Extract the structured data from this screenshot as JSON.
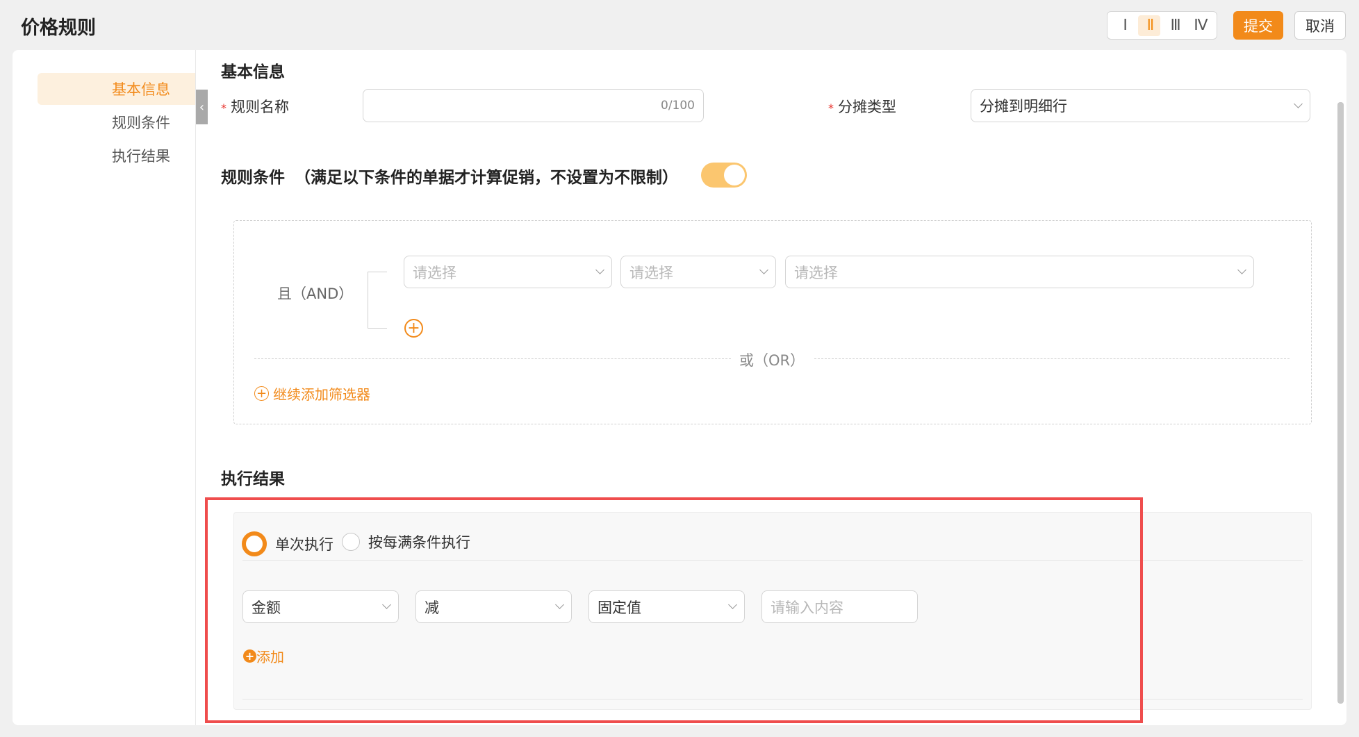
{
  "header": {
    "title": "价格规则",
    "column_options": [
      "Ⅰ",
      "Ⅱ",
      "Ⅲ",
      "Ⅳ"
    ],
    "active_column": 1,
    "submit_label": "提交",
    "cancel_label": "取消"
  },
  "sidebar": {
    "items": [
      {
        "label": "基本信息",
        "active": true
      },
      {
        "label": "规则条件",
        "active": false
      },
      {
        "label": "执行结果",
        "active": false
      }
    ]
  },
  "basic": {
    "heading": "基本信息",
    "rule_name_label": "规则名称",
    "rule_name_value": "",
    "rule_name_counter": "0/100",
    "alloc_type_label": "分摊类型",
    "alloc_type_value": "分摊到明细行"
  },
  "conditions": {
    "heading": "规则条件",
    "note": "（满足以下条件的单据才计算促销，不设置为不限制）",
    "enabled": true,
    "and_label": "且（AND）",
    "select_placeholder": "请选择",
    "or_label": "或（OR）",
    "add_filter_label": "继续添加筛选器"
  },
  "results": {
    "heading": "执行结果",
    "mode_options": [
      {
        "label": "单次执行",
        "checked": true
      },
      {
        "label": "按每满条件执行",
        "checked": false
      }
    ],
    "field_value": "金额",
    "operator_value": "减",
    "value_type": "固定值",
    "amount_placeholder": "请输入内容",
    "add_label": "添加"
  },
  "colors": {
    "accent": "#f28a1a",
    "highlight_border": "#ef4d4d"
  }
}
